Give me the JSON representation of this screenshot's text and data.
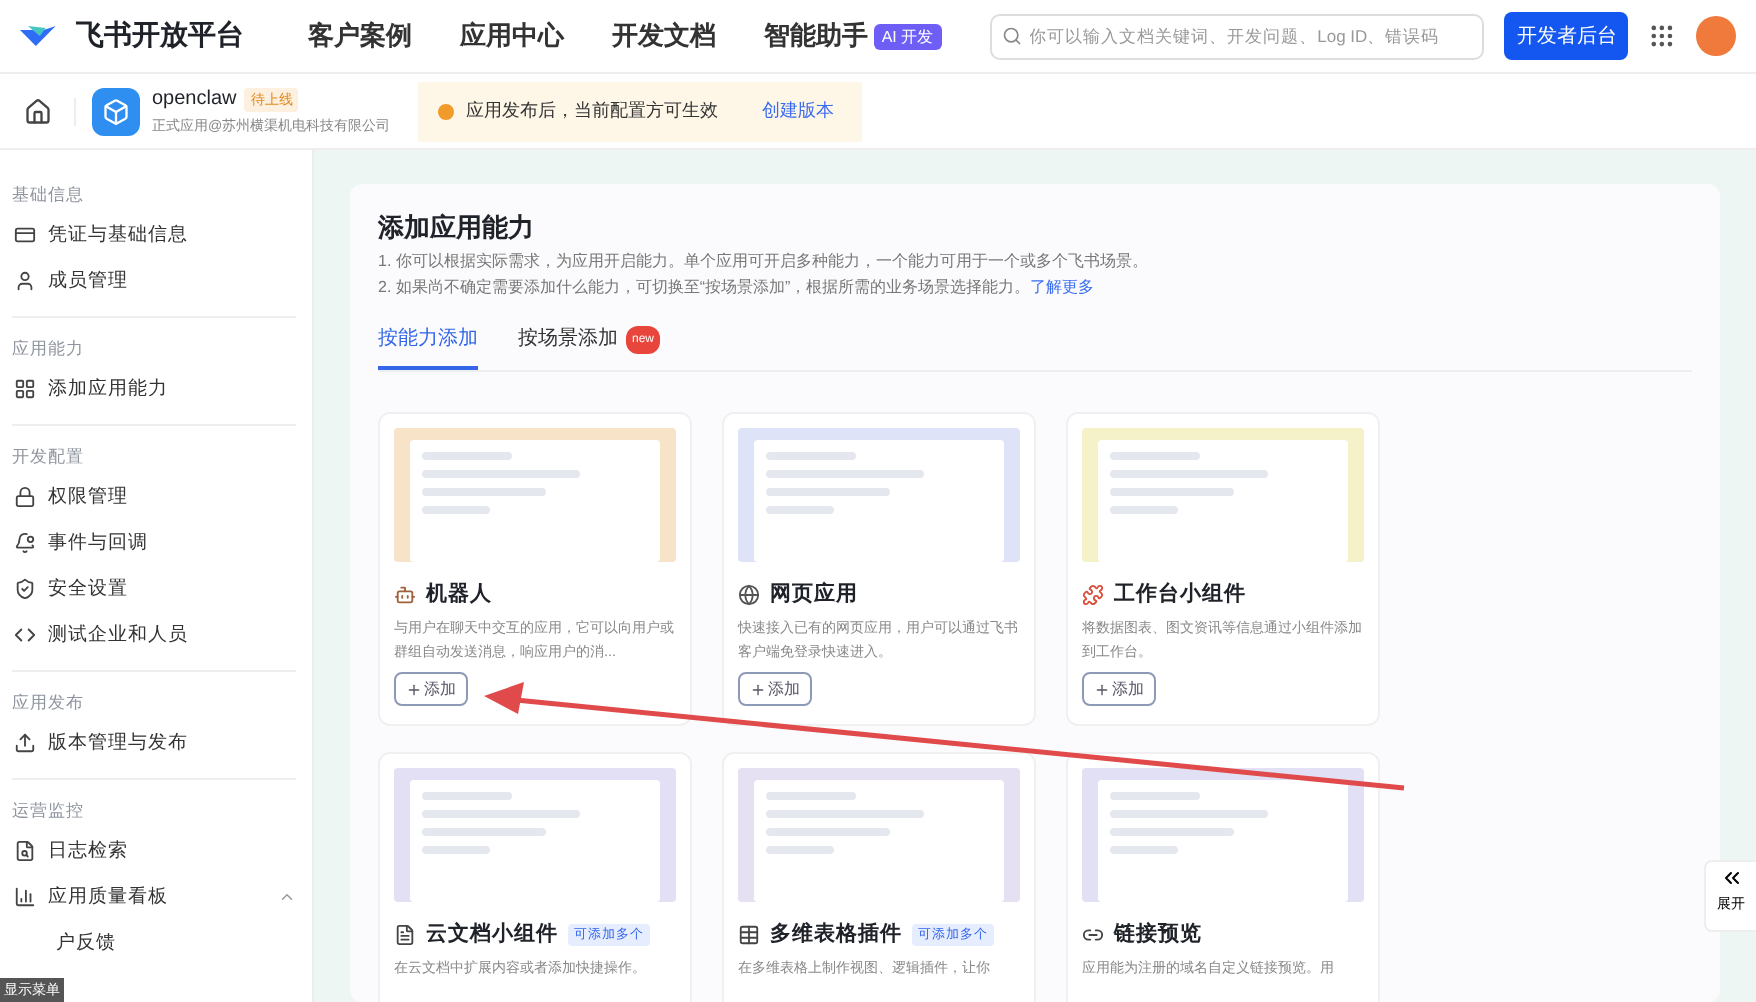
{
  "topbar": {
    "brand": "飞书开放平台",
    "nav": [
      {
        "label": "客户案例"
      },
      {
        "label": "应用中心"
      },
      {
        "label": "开发文档"
      },
      {
        "label": "智能助手",
        "badge": "AI 开发"
      }
    ],
    "search": {
      "placeholder": "你可以输入文档关键词、开发问题、Log ID、错误码"
    },
    "console_button": "开发者后台"
  },
  "app_header": {
    "name": "openclaw",
    "status": "待上线",
    "subtitle": "正式应用@苏州横渠机电科技有限公司",
    "notice": "应用发布后，当前配置方可生效",
    "notice_action": "创建版本"
  },
  "sidebar": {
    "groups": [
      {
        "label": "基础信息",
        "items": [
          {
            "label": "凭证与基础信息",
            "selected": false
          },
          {
            "label": "成员管理",
            "selected": false
          }
        ]
      },
      {
        "label": "应用能力",
        "items": [
          {
            "label": "添加应用能力",
            "selected": false
          }
        ]
      },
      {
        "label": "开发配置",
        "items": [
          {
            "label": "权限管理",
            "selected": false
          },
          {
            "label": "事件与回调",
            "selected": false
          },
          {
            "label": "安全设置",
            "selected": false
          },
          {
            "label": "测试企业和人员",
            "selected": false
          }
        ]
      },
      {
        "label": "应用发布",
        "items": [
          {
            "label": "版本管理与发布",
            "selected": false
          }
        ]
      },
      {
        "label": "运营监控",
        "items": [
          {
            "label": "日志检索",
            "selected": false
          },
          {
            "label": "应用质量看板",
            "selected": false,
            "expanded": true
          },
          {
            "label": "户反馈",
            "selected": false
          }
        ]
      }
    ],
    "menu_badge": "显示菜单"
  },
  "content": {
    "title": "添加应用能力",
    "notes": [
      "1. 你可以根据实际需求，为应用开启能力。单个应用可开启多种能力，一个能力可用于一个或多个飞书场景。",
      "2. 如果尚不确定需要添加什么能力，可切换至“按场景添加”，根据所需的业务场景选择能力。"
    ],
    "learn_more": "了解更多",
    "tabs": [
      {
        "label": "按能力添加",
        "selected": true
      },
      {
        "label": "按场景添加",
        "selected": false,
        "badge": "new"
      }
    ],
    "cards": [
      {
        "title": "机器人",
        "color": "#f7e3c8",
        "description": "与用户在聊天中交互的应用，它可以向用户或群组自动发送消息，响应用户的消...",
        "button": "添加"
      },
      {
        "title": "网页应用",
        "color": "#dfe3f7",
        "description": "快速接入已有的网页应用，用户可以通过飞书客户端免登录快速进入。",
        "button": "添加"
      },
      {
        "title": "工作台小组件",
        "color": "#f5f1c9",
        "description": "将数据图表、图文资讯等信息通过小组件添加到工作台。",
        "button": "添加"
      },
      {
        "title": "云文档小组件",
        "tag": "可添加多个",
        "color": "#e3e0f5",
        "description": "在云文档中扩展内容或者添加快捷操作。"
      },
      {
        "title": "多维表格插件",
        "tag": "可添加多个",
        "color": "#e6e0f3",
        "description": "在多维表格上制作视图、逻辑插件，让你"
      },
      {
        "title": "链接预览",
        "color": "#e2e0f4",
        "description": "应用能为注册的域名自定义链接预览。用"
      }
    ]
  },
  "expand_button": "展开"
}
